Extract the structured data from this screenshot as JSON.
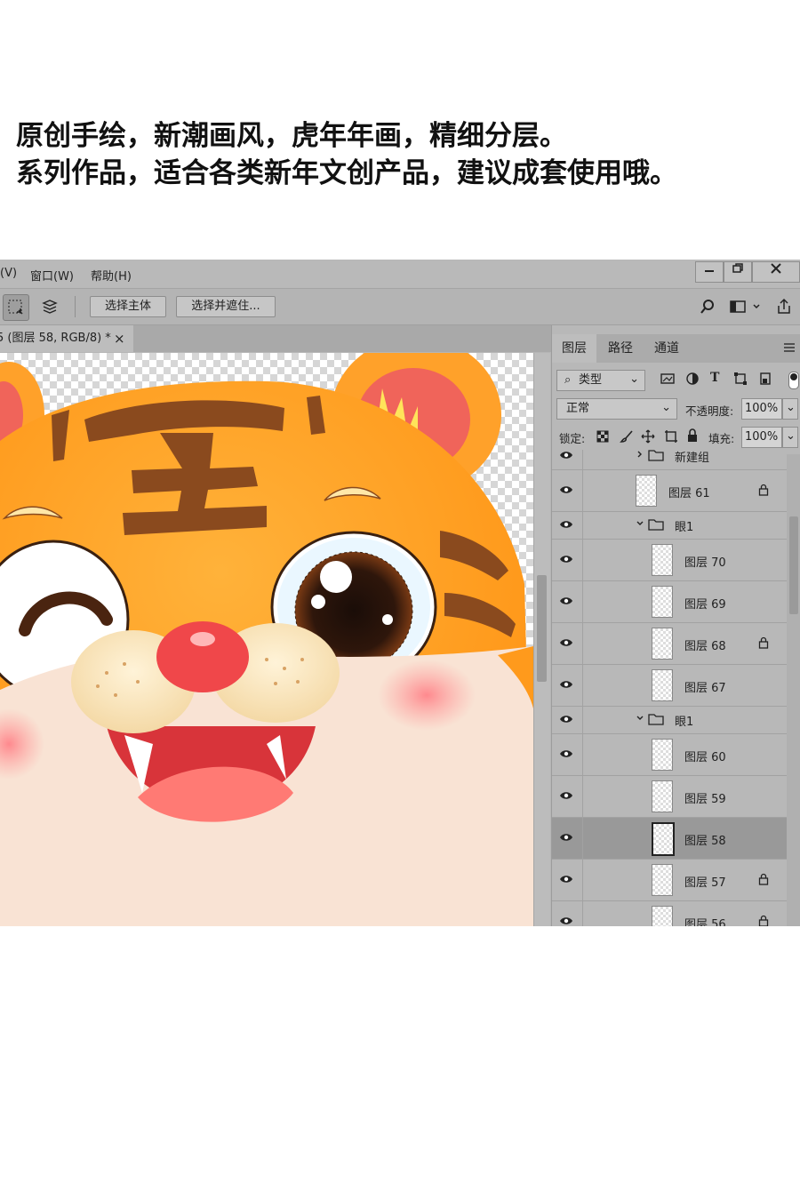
{
  "caption": {
    "line1": "原创手绘，新潮画风，虎年年画，精细分层。",
    "line2": "系列作品，适合各类新年文创产品，建议成套使用哦。"
  },
  "menubar": {
    "items": [
      "(V)",
      "窗口(W)",
      "帮助(H)"
    ],
    "window_controls": [
      "minimize-icon",
      "restore-icon",
      "close-icon"
    ]
  },
  "options_bar": {
    "select_subject": "选择主体",
    "select_and_mask": "选择并遮住...",
    "right_icons": [
      "search-icon",
      "workspace-icon",
      "share-icon"
    ]
  },
  "document_tab": {
    "label": "5 (图层 58, RGB/8) *",
    "close": "×"
  },
  "layers_panel": {
    "tabs": [
      "图层",
      "路径",
      "通道"
    ],
    "active_tab": "图层",
    "filter_label": "类型",
    "blend_mode": "正常",
    "opacity_label": "不透明度:",
    "opacity_value": "100%",
    "lock_label": "锁定:",
    "fill_label": "填充:",
    "fill_value": "100%",
    "layers": [
      {
        "name": "新建组",
        "type": "group",
        "indent": 0,
        "expanded": false,
        "locked": false,
        "selected": false
      },
      {
        "name": "图层 61",
        "type": "layer",
        "indent": 0,
        "locked": true,
        "selected": false
      },
      {
        "name": "眼1",
        "type": "group",
        "indent": 0,
        "expanded": true,
        "locked": false,
        "selected": false
      },
      {
        "name": "图层 70",
        "type": "layer",
        "indent": 1,
        "locked": false,
        "selected": false
      },
      {
        "name": "图层 69",
        "type": "layer",
        "indent": 1,
        "locked": false,
        "selected": false
      },
      {
        "name": "图层 68",
        "type": "layer",
        "indent": 1,
        "locked": true,
        "selected": false
      },
      {
        "name": "图层 67",
        "type": "layer",
        "indent": 1,
        "locked": false,
        "selected": false
      },
      {
        "name": "眼1",
        "type": "group",
        "indent": 0,
        "expanded": true,
        "locked": false,
        "selected": false
      },
      {
        "name": "图层 60",
        "type": "layer",
        "indent": 1,
        "locked": false,
        "selected": false
      },
      {
        "name": "图层 59",
        "type": "layer",
        "indent": 1,
        "locked": false,
        "selected": false
      },
      {
        "name": "图层 58",
        "type": "layer",
        "indent": 1,
        "locked": false,
        "selected": true
      },
      {
        "name": "图层 57",
        "type": "layer",
        "indent": 1,
        "locked": true,
        "selected": false
      },
      {
        "name": "图层 56",
        "type": "layer",
        "indent": 1,
        "locked": true,
        "selected": false
      }
    ]
  },
  "colors": {
    "ui_bg": "#b5b5b5",
    "tiger_orange": "#ff9c1f",
    "stripe_brown": "#8a4a1e",
    "nose_red": "#f0474a",
    "cheek_pink": "#ff8a8a"
  }
}
